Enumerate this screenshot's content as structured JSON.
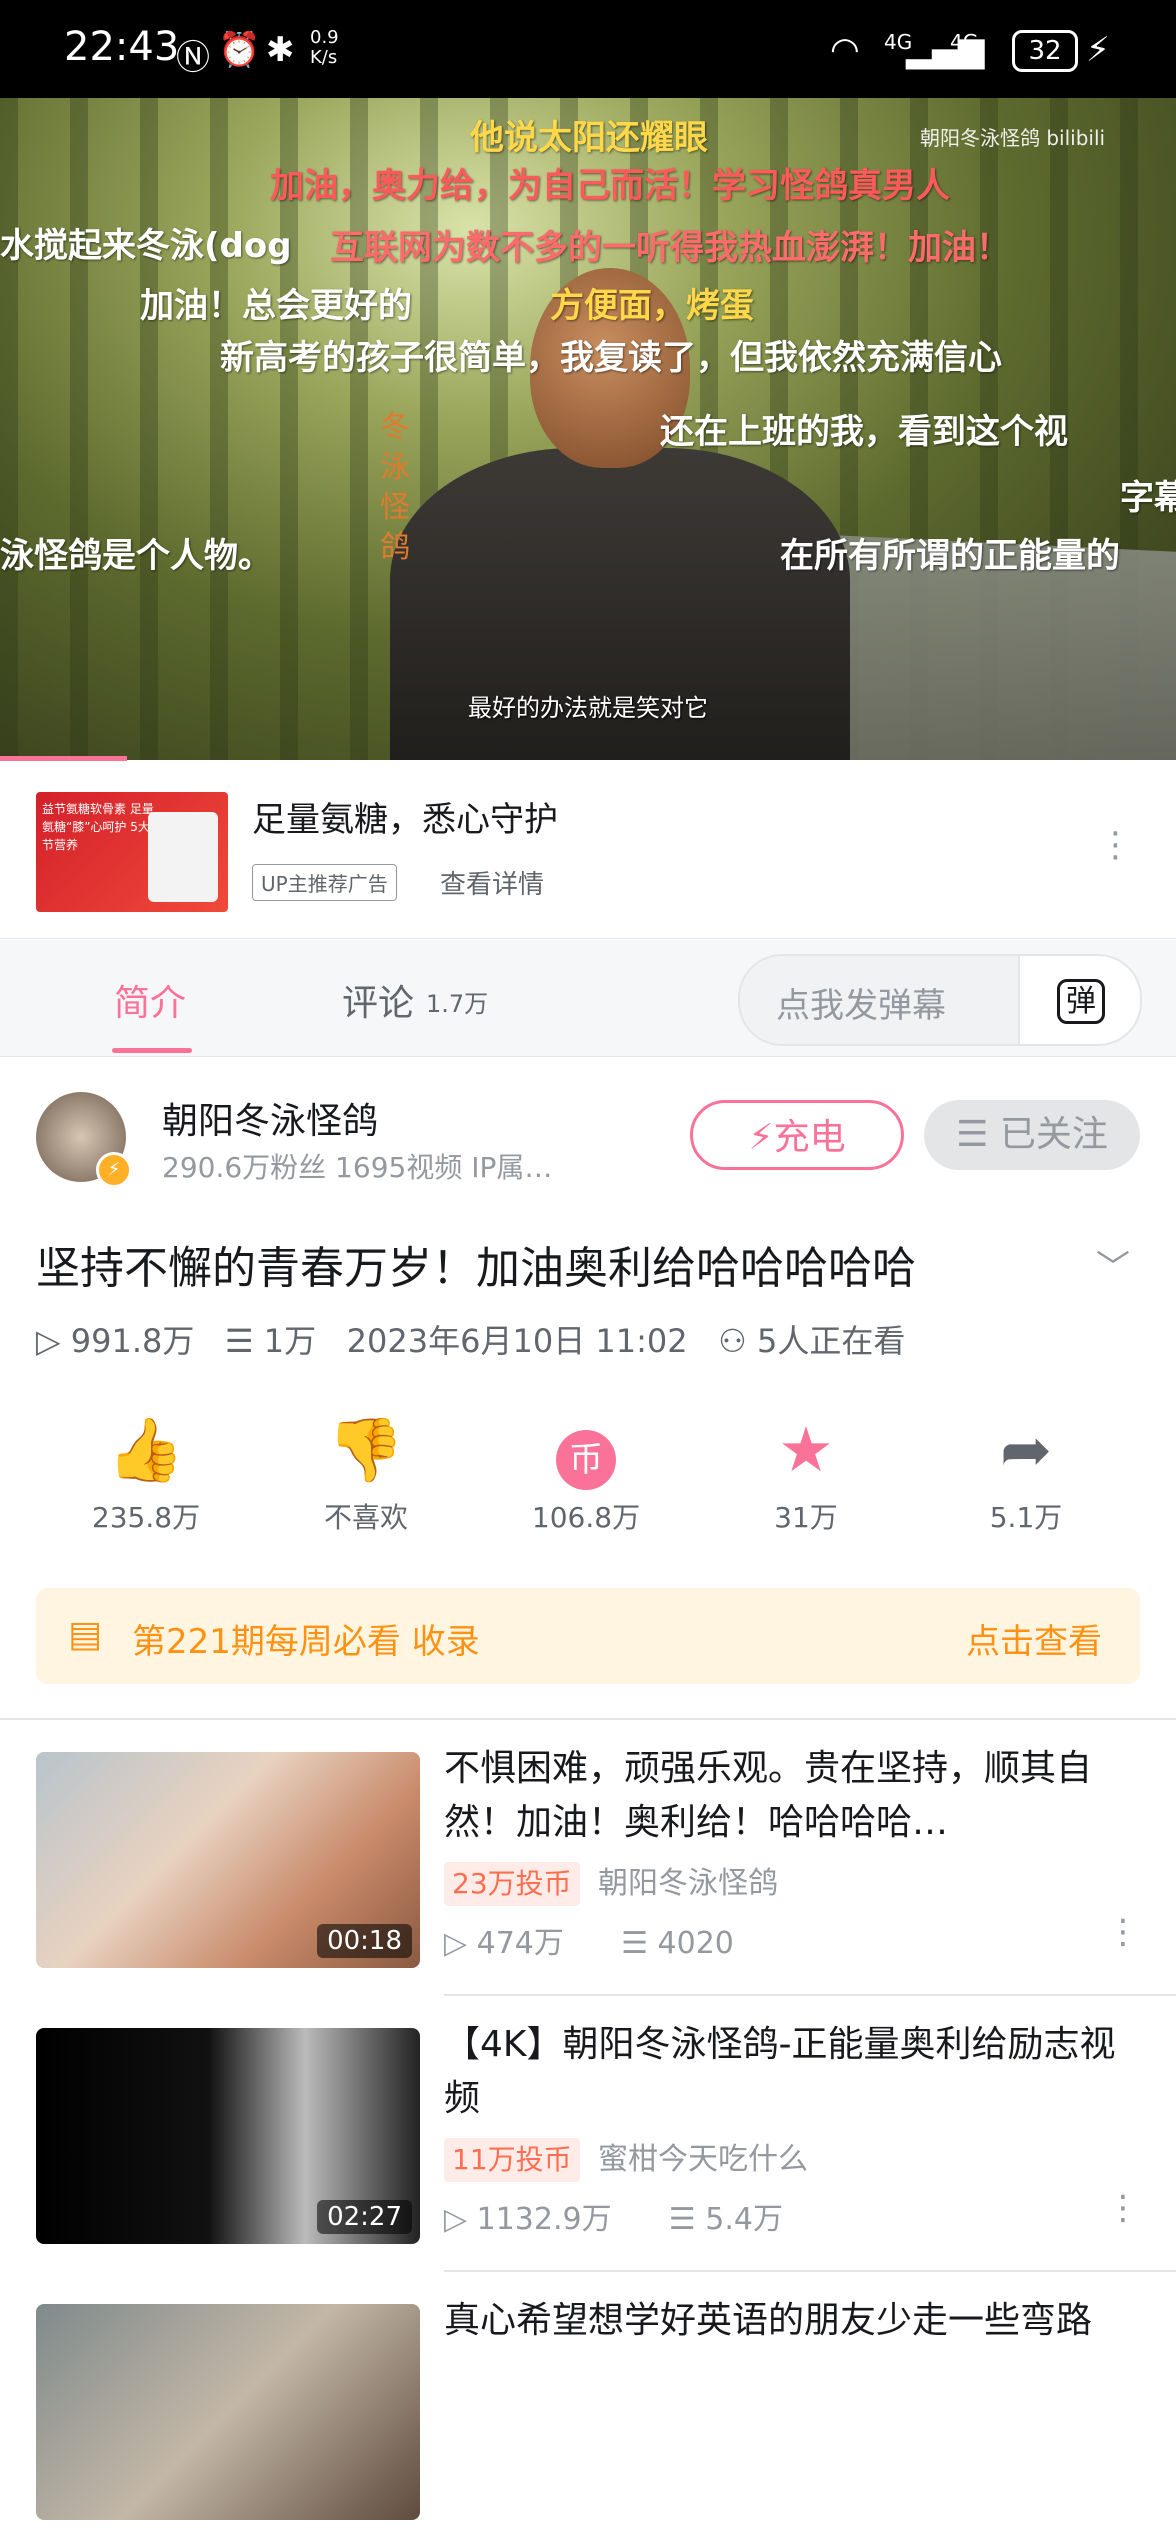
{
  "status_bar": {
    "time": "22:43",
    "speed": "0.9\nK/s",
    "signal_1": "4G",
    "signal_2": "4G",
    "battery": "32"
  },
  "video": {
    "logo": "朝阳冬泳怪鸽 bilibili",
    "subtitle": "最好的办法就是笑对它",
    "watermark": "冬泳怪鸽",
    "danmaku": [
      {
        "text": "他说太阳还耀眼",
        "color": "#ffd84a"
      },
      {
        "text": "加油，奥力给，为自己而活！学习怪鸽真男人",
        "color": "#ff5a5a"
      },
      {
        "text": "水搅起来冬泳(dog",
        "color": "#ffffff"
      },
      {
        "text": "互联网为数不多的一听得我热血澎湃！加油！",
        "color": "#ff6a6a"
      },
      {
        "text": "加油！总会更好的",
        "color": "#ffffff"
      },
      {
        "text": "方便面，烤蛋",
        "color": "#ffd84a"
      },
      {
        "text": "新高考的孩子很简单，我复读了，但我依然充满信心",
        "color": "#ffffff"
      },
      {
        "text": "还在上班的我，看到这个视",
        "color": "#ffffff"
      },
      {
        "text": "字幕",
        "color": "#ffffff"
      },
      {
        "text": "泳怪鸽是个人物。",
        "color": "#ffffff"
      },
      {
        "text": "在所有所谓的正能量的",
        "color": "#ffffff"
      }
    ],
    "progress_fraction": 0.108
  },
  "ad": {
    "title": "足量氨糖，悉心守护",
    "tag": "UP主推荐广告",
    "detail_link": "查看详情",
    "thumb_text": "益节氨糖软骨素 足量氨糖“膝”心呵护 5大关节营养"
  },
  "tabs": {
    "intro": "简介",
    "comments": "评论",
    "comments_count": "1.7万",
    "danmaku_placeholder": "点我发弹幕",
    "danmaku_button": "弹"
  },
  "author": {
    "name": "朝阳冬泳怪鸽",
    "stats": "290.6万粉丝    1695视频    IP属…",
    "charge": "⚡充电",
    "follow": "☰ 已关注"
  },
  "video_info": {
    "title": "坚持不懈的青春万岁！加油奥利给哈哈哈哈哈",
    "views": "991.8万",
    "danmaku": "1万",
    "date": "2023年6月10日 11:02",
    "watching": "5人正在看"
  },
  "actions": [
    {
      "icon": "thumb-up-icon",
      "glyph": "👍",
      "label": "235.8万",
      "color": "#fb7299"
    },
    {
      "icon": "thumb-down-icon",
      "glyph": "👎",
      "label": "不喜欢",
      "color": "#61666d"
    },
    {
      "icon": "coin-icon",
      "glyph": "币",
      "label": "106.8万",
      "color": "#fb7299"
    },
    {
      "icon": "star-icon",
      "glyph": "★",
      "label": "31万",
      "color": "#fb7299"
    },
    {
      "icon": "share-icon",
      "glyph": "➦",
      "label": "5.1万",
      "color": "#61666d"
    }
  ],
  "weekly": {
    "text": "第221期每周必看 收录",
    "link": "点击查看"
  },
  "related": [
    {
      "title": "不惧困难，顽强乐观。贵在坚持，顺其自然！加油！奥利给！哈哈哈哈…",
      "duration": "00:18",
      "coin": "23万投币",
      "up": "朝阳冬泳怪鸽",
      "views": "474万",
      "danmaku": "4020"
    },
    {
      "title": "【4K】朝阳冬泳怪鸽-正能量奥利给励志视频",
      "duration": "02:27",
      "coin": "11万投币",
      "up": "蜜柑今天吃什么",
      "views": "1132.9万",
      "danmaku": "5.4万"
    },
    {
      "title": "真心希望想学好英语的朋友少走一些弯路",
      "duration": "",
      "coin": "",
      "up": "",
      "views": "",
      "danmaku": ""
    }
  ]
}
